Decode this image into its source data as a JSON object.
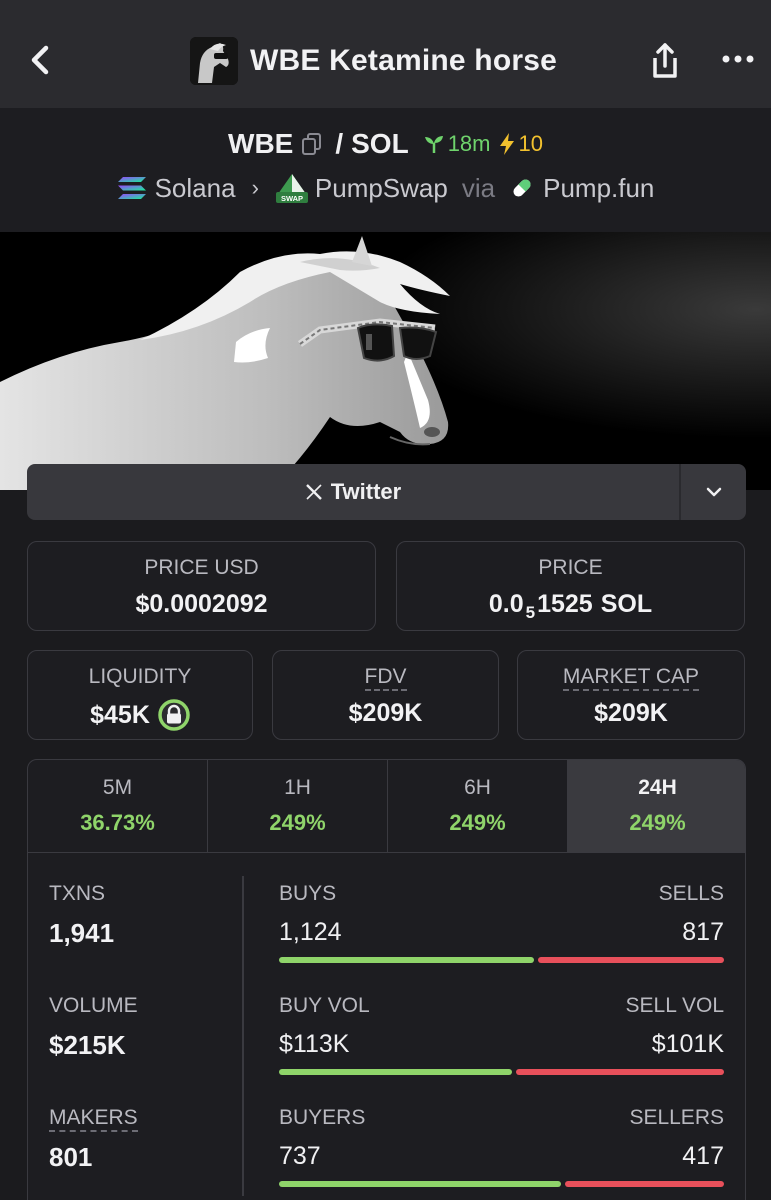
{
  "header": {
    "title": "WBE Ketamine horse"
  },
  "pair": {
    "base": "WBE",
    "separator": "/",
    "quote": "SOL",
    "age": "18m",
    "boosts": "10",
    "chain": "Solana",
    "dex": "PumpSwap",
    "via_label": "via",
    "launchpad": "Pump.fun",
    "dex_icon_text": "SWAP"
  },
  "twitter": {
    "label": "Twitter"
  },
  "price": {
    "usd_label": "PRICE USD",
    "usd_value": "$0.0002092",
    "native_label": "PRICE",
    "native_prefix": "0.0",
    "native_zeros": "5",
    "native_digits": "1525",
    "native_unit": "SOL"
  },
  "metrics": {
    "liquidity_label": "LIQUIDITY",
    "liquidity_value": "$45K",
    "fdv_label": "FDV",
    "fdv_value": "$209K",
    "mcap_label": "MARKET CAP",
    "mcap_value": "$209K"
  },
  "tabs": [
    {
      "label": "5M",
      "value": "36.73%"
    },
    {
      "label": "1H",
      "value": "249%"
    },
    {
      "label": "6H",
      "value": "249%"
    },
    {
      "label": "24H",
      "value": "249%"
    }
  ],
  "stats": {
    "txns_label": "TXNS",
    "txns_value": "1,941",
    "volume_label": "VOLUME",
    "volume_value": "$215K",
    "makers_label": "MAKERS",
    "makers_value": "801",
    "buys_label": "BUYS",
    "buys_value": "1,124",
    "sells_label": "SELLS",
    "sells_value": "817",
    "buys_share": 0.579,
    "buyvol_label": "BUY VOL",
    "buyvol_value": "$113K",
    "sellvol_label": "SELL VOL",
    "sellvol_value": "$101K",
    "buyvol_share": 0.528,
    "buyers_label": "BUYERS",
    "buyers_value": "737",
    "sellers_label": "SELLERS",
    "sellers_value": "417",
    "buyers_share": 0.639
  },
  "colors": {
    "positive": "#8fd46a",
    "negative": "#e8505b",
    "age_green": "#6fd36c",
    "boost_yellow": "#f2c12e"
  },
  "icons": {
    "back": "chevron-left-icon",
    "share": "share-icon",
    "more": "more-icon",
    "copy": "copy-icon",
    "age": "seedling-icon",
    "boost": "lightning-icon",
    "chain": "solana-icon",
    "dex": "pumpswap-icon",
    "launchpad": "pill-icon",
    "twitter": "x-icon",
    "dropdown": "chevron-down-icon",
    "lock": "lock-icon"
  }
}
